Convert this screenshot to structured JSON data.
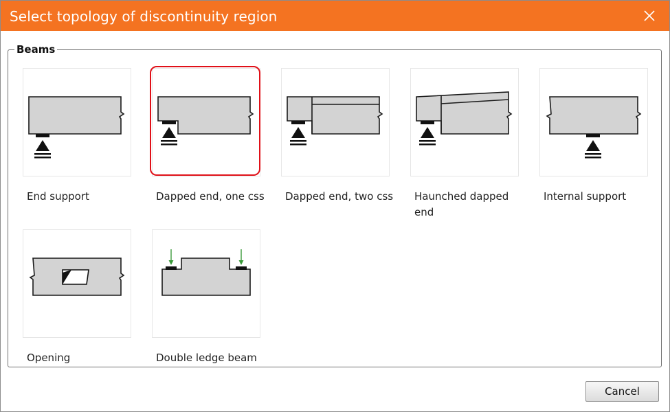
{
  "dialog": {
    "title": "Select topology of discontinuity region",
    "close_icon": "close-icon"
  },
  "group": {
    "title": "Beams"
  },
  "items": [
    {
      "label": "End support",
      "icon": "end-support-icon",
      "selected": false
    },
    {
      "label": "Dapped end, one css",
      "icon": "dapped-end-one-css-icon",
      "selected": true
    },
    {
      "label": "Dapped end, two css",
      "icon": "dapped-end-two-css-icon",
      "selected": false
    },
    {
      "label": "Haunched dapped end",
      "icon": "haunched-dapped-end-icon",
      "selected": false
    },
    {
      "label": "Internal support",
      "icon": "internal-support-icon",
      "selected": false
    },
    {
      "label": "Opening",
      "icon": "opening-icon",
      "selected": false
    },
    {
      "label": "Double ledge beam",
      "icon": "double-ledge-beam-icon",
      "selected": false
    }
  ],
  "buttons": {
    "cancel": "Cancel"
  },
  "colors": {
    "titlebar": "#f47321",
    "selection": "#e01018",
    "beam_fill": "#d3d3d3",
    "load_arrow": "#3a9a3a"
  }
}
